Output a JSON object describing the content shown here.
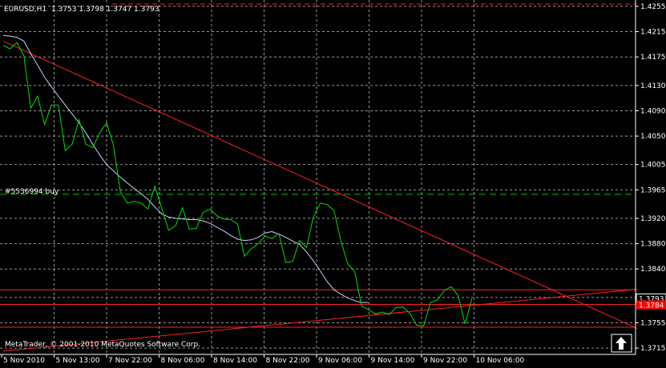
{
  "header": {
    "symbol_timeframe": "EURUSD,H1",
    "ohlc": "1.3753 1.3798 1.3747 1.3793"
  },
  "order_label": "#5536994 buy",
  "watermark": "MetaTrader, © 2001-2010 MetaQuotes Software Corp.",
  "price_tags": {
    "bid": "1.3793",
    "order_line": "1.3784"
  },
  "colors": {
    "background": "#000000",
    "grid": "#c8c8c8",
    "price_line": "#00e000",
    "moving_average": "#c8d2ff",
    "trendline": "#ff2020",
    "order_line": "#00c000",
    "text": "#ffffff"
  },
  "chart_data": {
    "type": "line",
    "title": "EURUSD,H1",
    "y_ticks": [
      "1.4255",
      "1.4215",
      "1.4175",
      "1.4130",
      "1.4090",
      "1.4050",
      "1.4005",
      "1.3965",
      "1.3920",
      "1.3880",
      "1.3840",
      "1.3795",
      "1.3755",
      "1.3715"
    ],
    "x_ticks": [
      "5 Nov 2010",
      "5 Nov 13:00",
      "7 Nov 22:00",
      "8 Nov 06:00",
      "8 Nov 14:00",
      "8 Nov 22:00",
      "9 Nov 06:00",
      "9 Nov 14:00",
      "9 Nov 22:00",
      "10 Nov 06:00"
    ],
    "ylim": [
      1.3705,
      1.4265
    ],
    "grid": true,
    "order_price": 1.3958,
    "horizontal_lines": [
      1.3807,
      1.3784,
      1.3748
    ],
    "trendlines": [
      {
        "name": "upper",
        "p1": {
          "bar": 0,
          "price": 1.42
        },
        "p2": {
          "bar": 92,
          "price": 1.3746
        }
      },
      {
        "name": "lower",
        "p1": {
          "bar": 0,
          "price": 1.371
        },
        "p2": {
          "bar": 92,
          "price": 1.3808
        }
      }
    ],
    "series": [
      {
        "name": "price",
        "values": [
          1.4193,
          1.4188,
          1.4198,
          1.4177,
          1.4094,
          1.4113,
          1.4068,
          1.4099,
          1.4099,
          1.4027,
          1.4037,
          1.4076,
          1.4037,
          1.4032,
          1.4055,
          1.4071,
          1.4035,
          1.3962,
          1.3944,
          1.3947,
          1.3944,
          1.3935,
          1.3971,
          1.3936,
          1.3901,
          1.3908,
          1.3937,
          1.3903,
          1.3904,
          1.3929,
          1.3935,
          1.3924,
          1.3919,
          1.3918,
          1.3911,
          1.386,
          1.3872,
          1.388,
          1.3892,
          1.3888,
          1.3896,
          1.385,
          1.3852,
          1.3885,
          1.3874,
          1.3922,
          1.3944,
          1.3942,
          1.3932,
          1.3884,
          1.3848,
          1.3836,
          1.3781,
          1.3776,
          1.3769,
          1.3772,
          1.3768,
          1.3779,
          1.378,
          1.377,
          1.3751,
          1.375,
          1.3787,
          1.3791,
          1.3806,
          1.3812,
          1.3798,
          1.3753,
          1.3793
        ]
      },
      {
        "name": "moving average",
        "values": [
          1.4209,
          1.4208,
          1.4206,
          1.42,
          1.418,
          1.4162,
          1.4143,
          1.4128,
          1.4113,
          1.4099,
          1.4085,
          1.4071,
          1.4055,
          1.4037,
          1.402,
          1.4005,
          1.3995,
          1.3985,
          1.3976,
          1.3967,
          1.3959,
          1.395,
          1.3938,
          1.3927,
          1.3922,
          1.392,
          1.3919,
          1.3918,
          1.3918,
          1.3916,
          1.3912,
          1.3906,
          1.39,
          1.3893,
          1.3887,
          1.3885,
          1.3886,
          1.389,
          1.3897,
          1.3899,
          1.3895,
          1.389,
          1.3884,
          1.3879,
          1.3867,
          1.3853,
          1.3837,
          1.382,
          1.3807,
          1.38,
          1.3794,
          1.379,
          1.3787,
          1.3787
        ]
      }
    ]
  }
}
